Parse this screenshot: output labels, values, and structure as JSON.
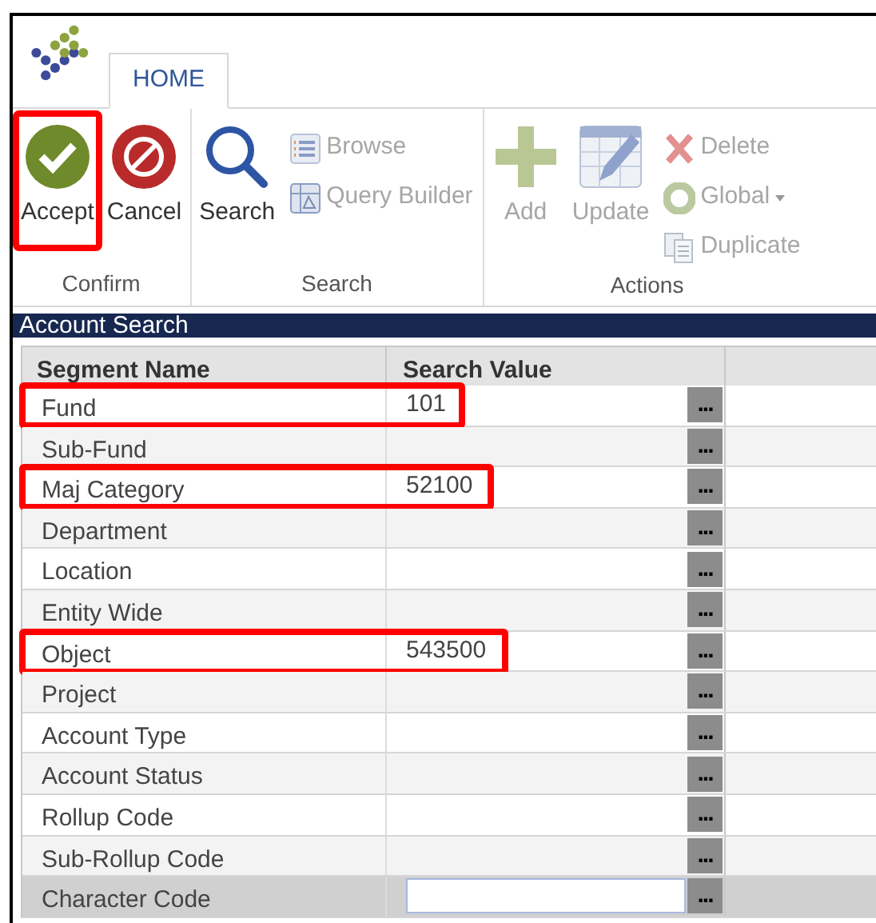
{
  "ribbon": {
    "tabs": [
      {
        "label": "HOME",
        "selected": true
      }
    ],
    "groups": [
      {
        "label": "Confirm",
        "items": [
          {
            "kind": "large",
            "label": "Accept",
            "disabled": false,
            "highlighted": true
          },
          {
            "kind": "large",
            "label": "Cancel",
            "disabled": false,
            "highlighted": false
          }
        ]
      },
      {
        "label": "Search",
        "items": [
          {
            "kind": "large",
            "label": "Search",
            "disabled": false,
            "highlighted": false
          },
          {
            "kind": "small",
            "label": "Browse",
            "disabled": true,
            "dropdown": false
          },
          {
            "kind": "small",
            "label": "Query Builder",
            "disabled": true,
            "dropdown": false
          }
        ]
      },
      {
        "label": "Actions",
        "items": [
          {
            "kind": "large",
            "label": "Add",
            "disabled": true,
            "highlighted": false
          },
          {
            "kind": "large",
            "label": "Update",
            "disabled": true,
            "highlighted": false
          },
          {
            "kind": "small",
            "label": "Delete",
            "disabled": true,
            "dropdown": false
          },
          {
            "kind": "small",
            "label": "Global",
            "disabled": true,
            "dropdown": true
          },
          {
            "kind": "small",
            "label": "Duplicate",
            "disabled": true,
            "dropdown": false
          }
        ]
      }
    ]
  },
  "panel": {
    "title": "Account Search"
  },
  "table": {
    "columns": [
      "Segment Name",
      "Search Value"
    ],
    "rows": [
      {
        "name": "Fund",
        "value": "101",
        "lookup": "...",
        "highlighted": true,
        "selected": false
      },
      {
        "name": "Sub-Fund",
        "value": "",
        "lookup": "...",
        "highlighted": false,
        "selected": false
      },
      {
        "name": "Maj Category",
        "value": "52100",
        "lookup": "...",
        "highlighted": true,
        "selected": false
      },
      {
        "name": "Department",
        "value": "",
        "lookup": "...",
        "highlighted": false,
        "selected": false
      },
      {
        "name": "Location",
        "value": "",
        "lookup": "...",
        "highlighted": false,
        "selected": false
      },
      {
        "name": "Entity Wide",
        "value": "",
        "lookup": "...",
        "highlighted": false,
        "selected": false
      },
      {
        "name": "Object",
        "value": "543500",
        "lookup": "...",
        "highlighted": true,
        "selected": false
      },
      {
        "name": "Project",
        "value": "",
        "lookup": "...",
        "highlighted": false,
        "selected": false
      },
      {
        "name": "Account Type",
        "value": "",
        "lookup": "...",
        "highlighted": false,
        "selected": false
      },
      {
        "name": "Account Status",
        "value": "",
        "lookup": "...",
        "highlighted": false,
        "selected": false
      },
      {
        "name": "Rollup Code",
        "value": "",
        "lookup": "...",
        "highlighted": false,
        "selected": false
      },
      {
        "name": "Sub-Rollup Code",
        "value": "",
        "lookup": "...",
        "highlighted": false,
        "selected": false
      },
      {
        "name": "Character Code",
        "value": "",
        "lookup": "...",
        "highlighted": false,
        "selected": true
      }
    ]
  }
}
